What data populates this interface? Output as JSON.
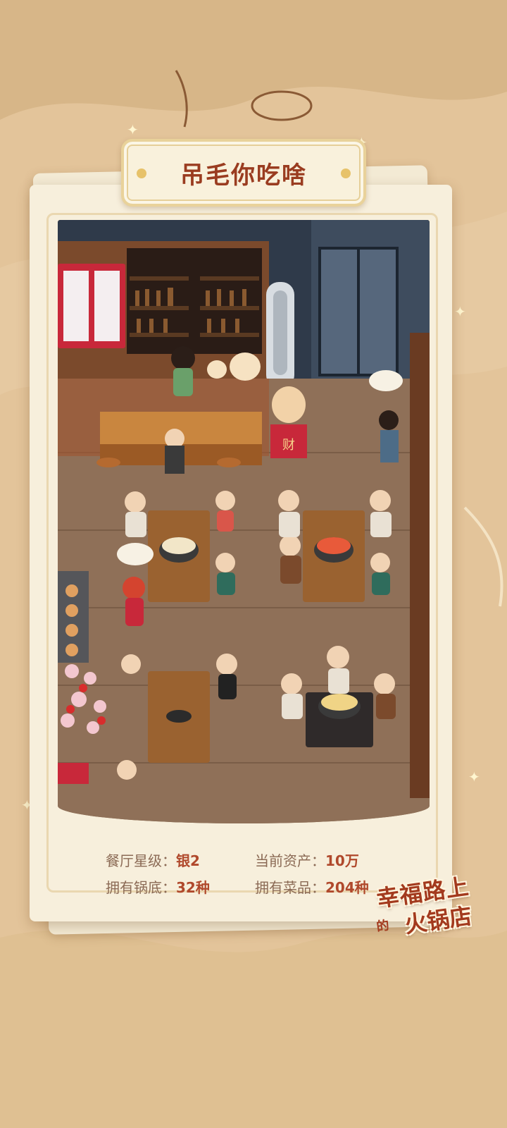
{
  "title": "吊毛你吃啥",
  "stats": {
    "rating": {
      "label": "餐厅星级：",
      "value": "银2"
    },
    "assets": {
      "label": "当前资产：",
      "value": "10万"
    },
    "bases": {
      "label": "拥有锅底：",
      "value": "32种"
    },
    "dishes": {
      "label": "拥有菜品：",
      "value": "204种"
    }
  },
  "logo": {
    "line1": "幸福路上",
    "small": "的",
    "line2": "火锅店"
  },
  "scene": {
    "cashier_sign": "财"
  },
  "colors": {
    "background": "#e3c49a",
    "title_text": "#9a3c20",
    "value_text": "#b0492c",
    "label_text": "#8b6a55"
  }
}
